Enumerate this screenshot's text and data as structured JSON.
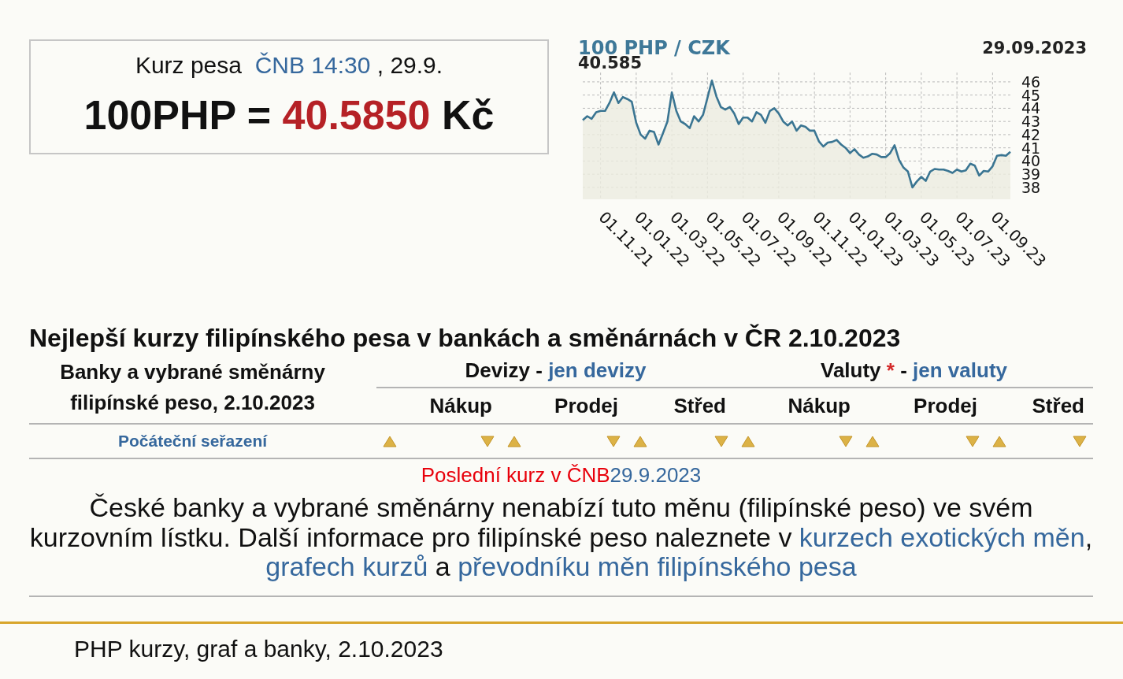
{
  "rate_box": {
    "label": "Kurz pesa",
    "source_link": "ČNB 14:30",
    "date": ", 29.9.",
    "amount": "100PHP =",
    "rate": "40.5850",
    "unit": "Kč"
  },
  "chart": {
    "last_value": "40.585",
    "date": "29.09.2023",
    "chart_data": {
      "type": "area",
      "title": "100 PHP / CZK",
      "grid": true,
      "categories": [
        null,
        null,
        null,
        null,
        "01.11.21",
        null,
        null,
        null,
        null,
        null,
        null,
        null,
        "01.01.22",
        null,
        null,
        null,
        null,
        null,
        null,
        null,
        "01.03.22",
        null,
        null,
        null,
        null,
        null,
        null,
        null,
        "01.05.22",
        null,
        null,
        null,
        null,
        null,
        null,
        null,
        "01.07.22",
        null,
        null,
        null,
        null,
        null,
        null,
        null,
        "01.09.22",
        null,
        null,
        null,
        null,
        null,
        null,
        null,
        "01.11.22",
        null,
        null,
        null,
        null,
        null,
        null,
        null,
        "01.01.23",
        null,
        null,
        null,
        null,
        null,
        null,
        null,
        "01.03.23",
        null,
        null,
        null,
        null,
        null,
        null,
        null,
        "01.05.23",
        null,
        null,
        null,
        null,
        null,
        null,
        null,
        "01.07.23",
        null,
        null,
        null,
        null,
        null,
        null,
        null,
        "01.09.23",
        null,
        null,
        null,
        null
      ],
      "series": [
        {
          "color": "#3a7592",
          "values": [
            43.1,
            43.4,
            43.2,
            43.7,
            43.8,
            43.8,
            44.4,
            45.2,
            44.4,
            44.85,
            44.7,
            44.5,
            42.9,
            42.0,
            41.7,
            42.3,
            42.2,
            41.25,
            42.1,
            43.0,
            45.2,
            43.8,
            43.0,
            42.8,
            42.5,
            43.4,
            43.0,
            43.5,
            44.8,
            46.1,
            44.9,
            44.1,
            43.9,
            44.1,
            43.6,
            42.8,
            43.3,
            43.3,
            43.0,
            43.7,
            43.5,
            42.9,
            43.8,
            44.0,
            43.6,
            43.0,
            42.7,
            43.0,
            42.3,
            42.7,
            42.6,
            42.3,
            42.3,
            41.5,
            41.1,
            41.4,
            41.45,
            41.6,
            41.25,
            41.0,
            40.6,
            40.9,
            40.5,
            40.25,
            40.35,
            40.55,
            40.5,
            40.3,
            40.3,
            40.6,
            41.2,
            40.1,
            39.5,
            39.2,
            38.0,
            38.45,
            38.8,
            38.5,
            39.2,
            39.4,
            39.35,
            39.35,
            39.25,
            39.1,
            39.35,
            39.2,
            39.3,
            39.8,
            39.65,
            38.9,
            39.25,
            39.2,
            39.6,
            40.4,
            40.45,
            40.4,
            40.7
          ]
        }
      ],
      "ylim": [
        37.1,
        46.7
      ],
      "yticks": [
        38,
        39,
        40,
        41,
        42,
        43,
        44,
        45,
        46
      ]
    }
  },
  "best_rates": {
    "heading": "Nejlepší kurzy filipínského pesa v bankách a směnárnách v ČR 2.10.2023",
    "bank_column": {
      "title": "Banky a vybrané směnárny",
      "subtitle": "filipínské peso, 2.10.2023"
    },
    "groups": [
      {
        "label": "Devizy",
        "separator": "-",
        "link": "jen devizy",
        "columns": [
          "Nákup",
          "Prodej",
          "Střed"
        ]
      },
      {
        "label": "Valuty",
        "asterisk": "*",
        "separator": "-",
        "link": "jen valuty",
        "columns": [
          "Nákup",
          "Prodej",
          "Střed"
        ]
      }
    ],
    "reset_sort": "Počáteční seřazení",
    "last_rate": {
      "label": "Poslední kurz v ČNB",
      "date": "29.9.2023"
    },
    "notice_lines": [
      [
        {
          "kind": "text",
          "text": "České banky a vybrané směnárny nenabízí tuto měnu (filipínské peso) ve svém"
        }
      ],
      [
        {
          "kind": "text",
          "text": "kurzovním lístku. Další informace pro filipínské peso naleznete v "
        },
        {
          "kind": "link",
          "text": "kurzech exotických měn"
        },
        {
          "kind": "text",
          "text": ","
        }
      ],
      [
        {
          "kind": "link",
          "text": "grafech kurzů"
        },
        {
          "kind": "text",
          "text": " a "
        },
        {
          "kind": "link",
          "text": "převodníku měn filipínského pesa"
        }
      ]
    ]
  },
  "footer": {
    "text": "PHP kurzy, graf a banky, 2.10.2023"
  }
}
